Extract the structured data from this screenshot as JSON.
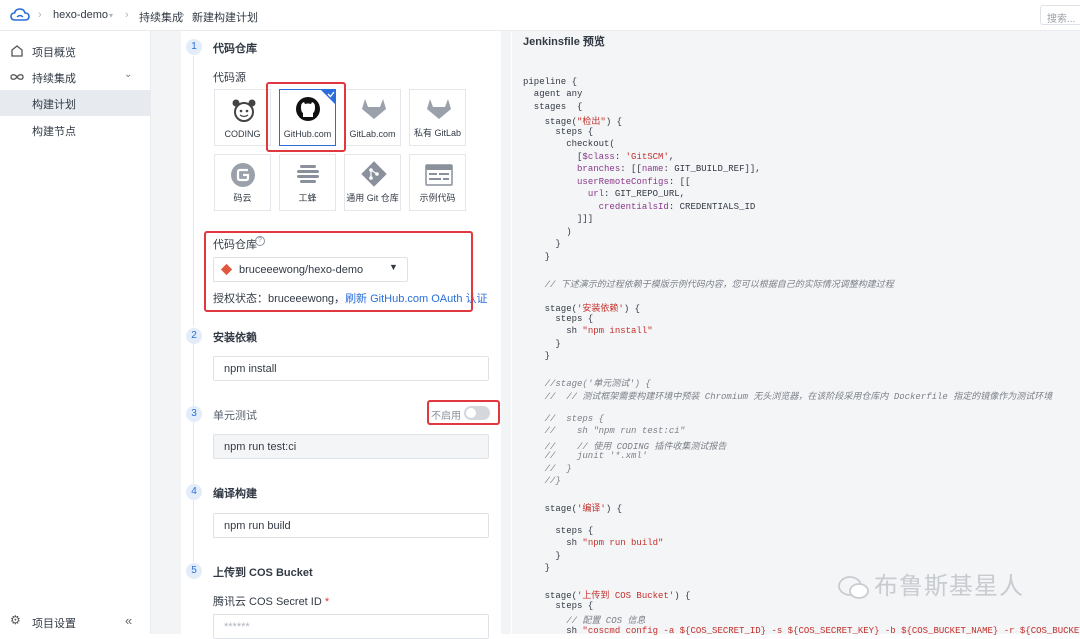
{
  "topbar": {
    "project": "hexo-demo",
    "section": "持续集成",
    "page": "新建构建计划",
    "search_placeholder": "搜索..."
  },
  "sidebar": {
    "items": [
      {
        "label": "项目概览",
        "icon": "home-icon"
      },
      {
        "label": "持续集成",
        "icon": "infinity-icon"
      },
      {
        "label": "构建计划",
        "icon": ""
      },
      {
        "label": "构建节点",
        "icon": ""
      }
    ],
    "settings": "项目设置",
    "collapse": "«"
  },
  "steps": [
    {
      "num": "1",
      "title": "代码仓库"
    },
    {
      "num": "2",
      "title": "安装依赖"
    },
    {
      "num": "3",
      "title": "单元测试"
    },
    {
      "num": "4",
      "title": "编译构建"
    },
    {
      "num": "5",
      "title": "上传到 COS Bucket"
    }
  ],
  "source": {
    "label": "代码源",
    "tiles": [
      "CODING",
      "GitHub.com",
      "GitLab.com",
      "私有 GitLab",
      "码云",
      "工蜂",
      "通用 Git 仓库",
      "示例代码"
    ],
    "selected": "GitHub.com"
  },
  "repo": {
    "label": "代码仓库",
    "value": "bruceeewong/hexo-demo",
    "auth_prefix": "授权状态：bruceeewong，",
    "auth_link": "刷新 GitHub.com OAuth 认证"
  },
  "install": {
    "value": "npm install"
  },
  "unit_test": {
    "toggle_label": "不启用",
    "value": "npm run test:ci",
    "enabled": false
  },
  "build": {
    "value": "npm run build"
  },
  "cos": {
    "secret_label": "腾讯云 COS Secret ID",
    "required": "*",
    "secret_value": "******"
  },
  "jenkins": {
    "title": "Jenkinsfile 预览",
    "lines": [
      "pipeline {",
      "  agent any",
      "  stages  {",
      "    stage(\"检出\") {",
      "      steps {",
      "        checkout(",
      "          [$class: 'GitSCM',",
      "          branches: [[name: GIT_BUILD_REF]],",
      "          userRemoteConfigs: [[",
      "            url: GIT_REPO_URL,",
      "              credentialsId: CREDENTIALS_ID",
      "          ]]]",
      "        )",
      "      }",
      "    }",
      "",
      "    // 下述演示的过程依赖于模版示例代码内容，您可以根据自己的实际情况调整构建过程",
      "",
      "    stage('安装依赖') {",
      "      steps {",
      "        sh \"npm install\"",
      "      }",
      "    }",
      "",
      "    //stage('单元测试') {",
      "    //  // 测试框架需要构建环境中预装 Chromium 无头浏览器，在该阶段采用仓库内 Dockerfile 指定的镜像作为测试环境",
      "",
      "    //  steps {",
      "    //    sh \"npm run test:ci\"",
      "    //    // 使用 CODING 插件收集测试报告",
      "    //    junit '*.xml'",
      "    //  }",
      "    //}",
      "",
      "    stage('编译') {",
      "",
      "      steps {",
      "        sh \"npm run build\"",
      "      }",
      "    }",
      "",
      "    stage('上传到 COS Bucket') {",
      "      steps {",
      "        // 配置 COS 信息",
      "        sh \"coscmd config -a ${COS_SECRET_ID} -s ${COS_SECRET_KEY} -b ${COS_BUCKET_NAME} -r ${COS_BUCKET_REGION}\""
    ]
  },
  "watermark": "布鲁斯基星人"
}
